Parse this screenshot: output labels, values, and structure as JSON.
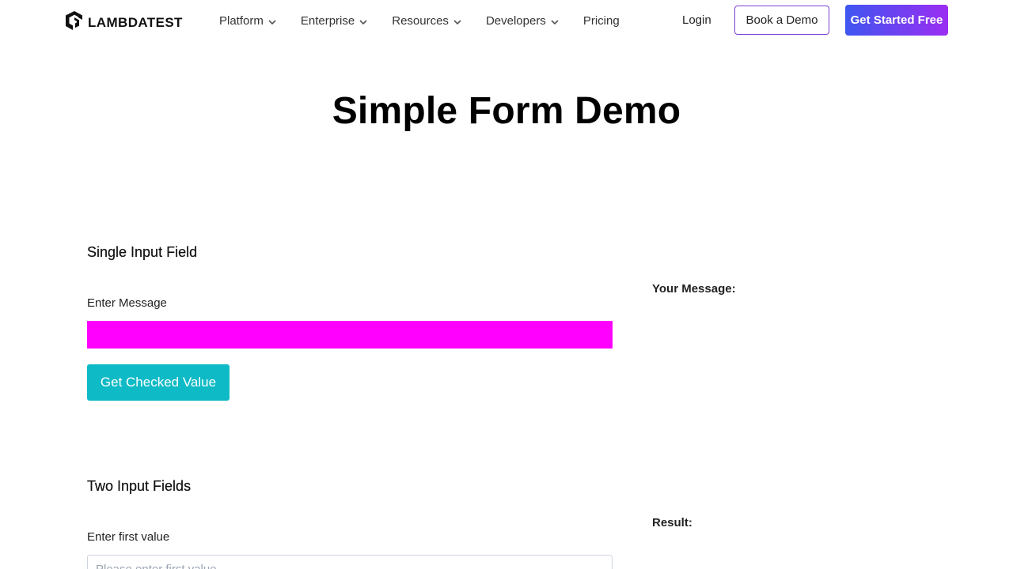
{
  "header": {
    "logo_text": "LAMBDATEST",
    "nav": [
      {
        "label": "Platform",
        "has_dropdown": true
      },
      {
        "label": "Enterprise",
        "has_dropdown": true
      },
      {
        "label": "Resources",
        "has_dropdown": true
      },
      {
        "label": "Developers",
        "has_dropdown": true
      },
      {
        "label": "Pricing",
        "has_dropdown": false
      }
    ],
    "login_label": "Login",
    "book_demo_label": "Book a Demo",
    "get_started_label": "Get Started Free"
  },
  "main": {
    "title": "Simple Form Demo",
    "single": {
      "section_title": "Single Input Field",
      "input_label": "Enter Message",
      "input_value": "",
      "button_label": "Get Checked Value",
      "output_label": "Your Message:"
    },
    "two": {
      "section_title": "Two Input Fields",
      "first_label": "Enter first value",
      "first_placeholder": "Please enter first value",
      "result_label": "Result:"
    }
  },
  "colors": {
    "accent_gradient_start": "#3f56f0",
    "accent_gradient_end": "#9b2df2",
    "highlight_input": "#ff00ff",
    "button_teal": "#0ebac5"
  },
  "icons": {
    "logo": "lambdatest-logo-icon",
    "dropdown": "chevron-down-icon"
  }
}
